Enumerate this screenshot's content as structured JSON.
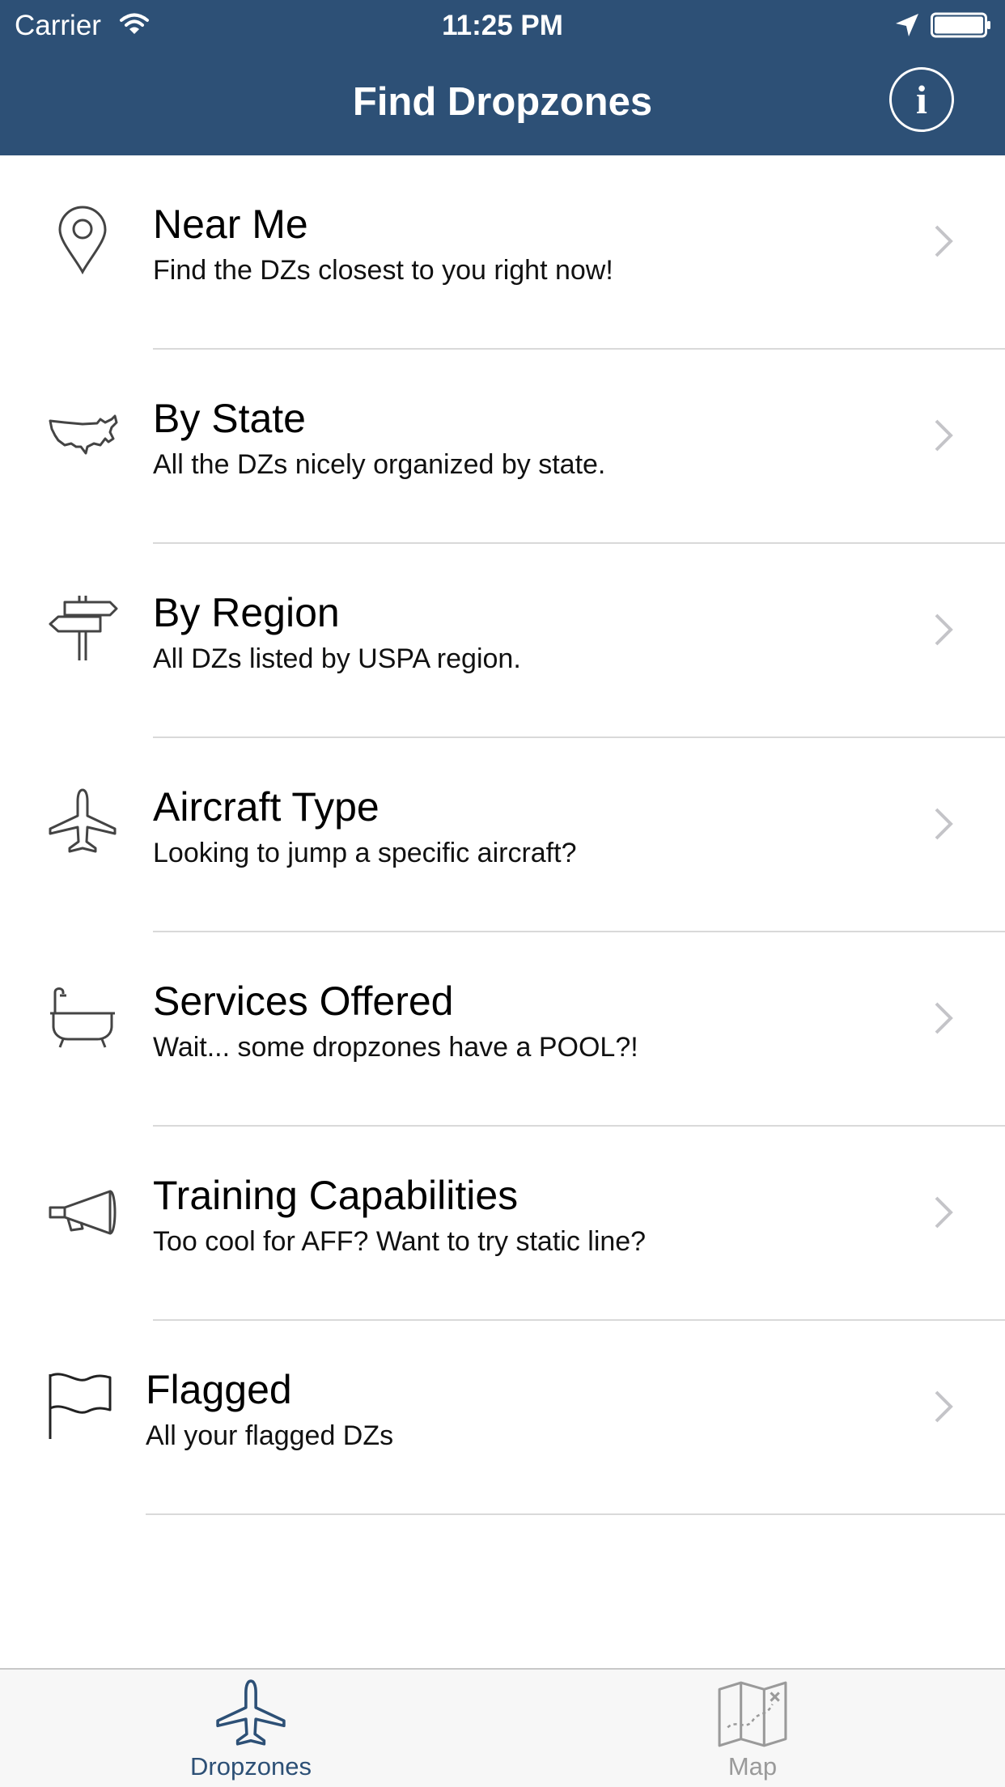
{
  "status_bar": {
    "carrier": "Carrier",
    "time": "11:25 PM"
  },
  "nav": {
    "title": "Find Dropzones",
    "info_label": "i"
  },
  "menu": [
    {
      "title": "Near Me",
      "subtitle": "Find the DZs closest to you right now!",
      "icon": "map-pin-icon"
    },
    {
      "title": "By State",
      "subtitle": "All the DZs nicely organized by state.",
      "icon": "usa-map-icon"
    },
    {
      "title": "By Region",
      "subtitle": "All DZs listed by USPA region.",
      "icon": "signpost-icon"
    },
    {
      "title": "Aircraft Type",
      "subtitle": "Looking to jump a specific aircraft?",
      "icon": "airplane-icon"
    },
    {
      "title": "Services Offered",
      "subtitle": "Wait... some dropzones have a POOL?!",
      "icon": "bathtub-icon"
    },
    {
      "title": "Training Capabilities",
      "subtitle": "Too cool for AFF? Want to try static line?",
      "icon": "megaphone-icon"
    },
    {
      "title": "Flagged",
      "subtitle": "All your flagged DZs",
      "icon": "flag-icon"
    }
  ],
  "tabs": [
    {
      "label": "Dropzones",
      "icon": "airplane-icon",
      "selected": true
    },
    {
      "label": "Map",
      "icon": "folded-map-icon",
      "selected": false
    }
  ],
  "colors": {
    "header_bg": "#2d5076",
    "tab_active": "#2d5076",
    "tab_inactive": "#9a9a9a",
    "separator": "#d9d9d9"
  }
}
